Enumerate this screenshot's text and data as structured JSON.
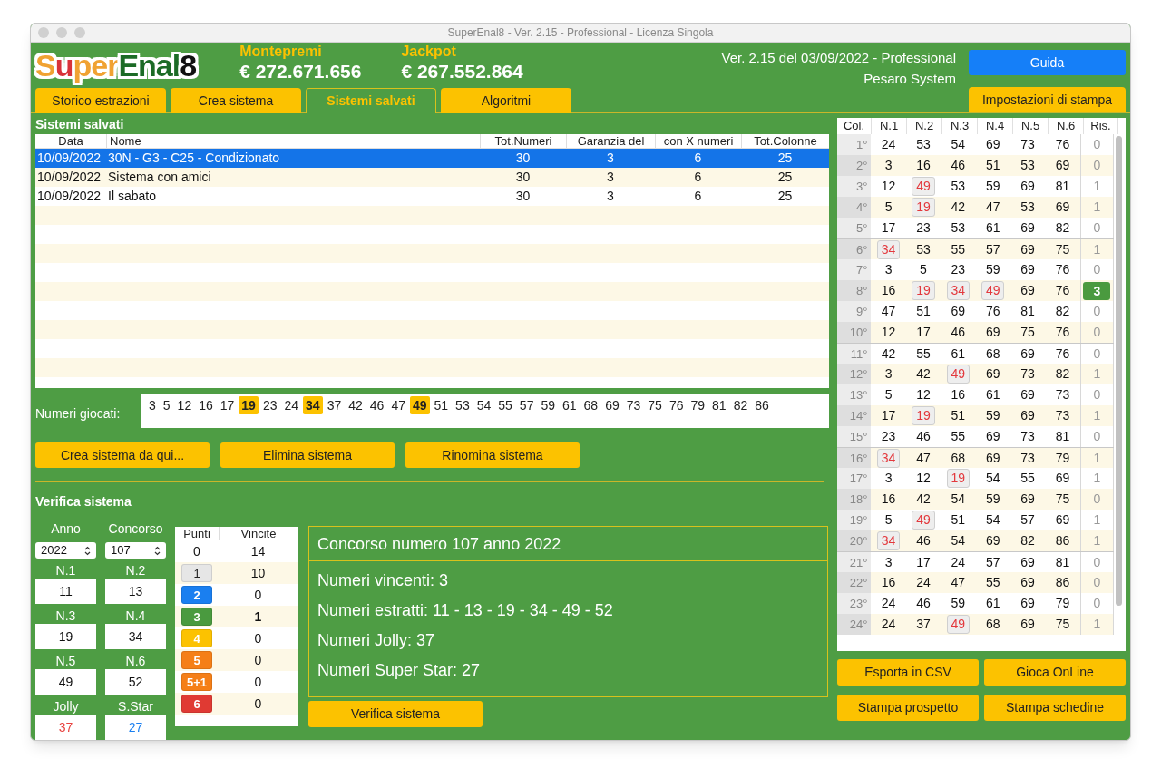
{
  "window": {
    "title": "SuperEnal8 - Ver. 2.15 - Professional - Licenza Singola"
  },
  "logo": [
    {
      "text": "S",
      "color": "#f0a232"
    },
    {
      "text": "u",
      "color": "#d8323a"
    },
    {
      "text": "per",
      "color": "#f0a232"
    },
    {
      "text": "Enal",
      "color": "#1c6b26"
    },
    {
      "text": "8",
      "color": "#111111"
    }
  ],
  "prizes": [
    {
      "label": "Montepremi",
      "amount": "€ 272.671.656"
    },
    {
      "label": "Jackpot",
      "amount": "€ 267.552.864"
    }
  ],
  "version": [
    "Ver. 2.15 del 03/09/2022 - Professional",
    "Pesaro System"
  ],
  "guide_button": "Guida",
  "tabs": [
    {
      "label": "Storico estrazioni",
      "selected": false
    },
    {
      "label": "Crea sistema",
      "selected": false
    },
    {
      "label": "Sistemi salvati",
      "selected": true
    },
    {
      "label": "Algoritmi",
      "selected": false
    }
  ],
  "print_settings_button": "Impostazioni di stampa",
  "saved_systems": {
    "title": "Sistemi salvati",
    "columns": [
      "Data",
      "Nome",
      "Tot.Numeri",
      "Garanzia del",
      "con X numeri",
      "Tot.Colonne"
    ],
    "rows": [
      {
        "cells": [
          "10/09/2022",
          "30N - G3 - C25 - Condizionato",
          "30",
          "3",
          "6",
          "25"
        ],
        "selected": true
      },
      {
        "cells": [
          "10/09/2022",
          "Sistema con amici",
          "30",
          "3",
          "6",
          "25"
        ],
        "selected": false
      },
      {
        "cells": [
          "10/09/2022",
          "Il sabato",
          "30",
          "3",
          "6",
          "25"
        ],
        "selected": false
      }
    ]
  },
  "played_numbers": {
    "label": "Numeri giocati:",
    "numbers": [
      {
        "value": "3",
        "hit": false
      },
      {
        "value": "5",
        "hit": false
      },
      {
        "value": "12",
        "hit": false
      },
      {
        "value": "16",
        "hit": false
      },
      {
        "value": "17",
        "hit": false
      },
      {
        "value": "19",
        "hit": true
      },
      {
        "value": "23",
        "hit": false
      },
      {
        "value": "24",
        "hit": false
      },
      {
        "value": "34",
        "hit": true
      },
      {
        "value": "37",
        "hit": false
      },
      {
        "value": "42",
        "hit": false
      },
      {
        "value": "46",
        "hit": false
      },
      {
        "value": "47",
        "hit": false
      },
      {
        "value": "49",
        "hit": true
      },
      {
        "value": "51",
        "hit": false
      },
      {
        "value": "53",
        "hit": false
      },
      {
        "value": "54",
        "hit": false
      },
      {
        "value": "55",
        "hit": false
      },
      {
        "value": "57",
        "hit": false
      },
      {
        "value": "59",
        "hit": false
      },
      {
        "value": "61",
        "hit": false
      },
      {
        "value": "68",
        "hit": false
      },
      {
        "value": "69",
        "hit": false
      },
      {
        "value": "73",
        "hit": false
      },
      {
        "value": "75",
        "hit": false
      },
      {
        "value": "76",
        "hit": false
      },
      {
        "value": "79",
        "hit": false
      },
      {
        "value": "81",
        "hit": false
      },
      {
        "value": "82",
        "hit": false
      },
      {
        "value": "86",
        "hit": false
      }
    ]
  },
  "system_buttons": [
    "Crea sistema da qui...",
    "Elimina sistema",
    "Rinomina sistema"
  ],
  "verify": {
    "title": "Verifica sistema",
    "year": {
      "label": "Anno",
      "value": "2022"
    },
    "contest": {
      "label": "Concorso",
      "value": "107"
    },
    "fields": [
      {
        "label": "N.1",
        "value": "11",
        "color": "#111111"
      },
      {
        "label": "N.2",
        "value": "13",
        "color": "#111111"
      },
      {
        "label": "N.3",
        "value": "19",
        "color": "#111111"
      },
      {
        "label": "N.4",
        "value": "34",
        "color": "#111111"
      },
      {
        "label": "N.5",
        "value": "49",
        "color": "#111111"
      },
      {
        "label": "N.6",
        "value": "52",
        "color": "#111111"
      },
      {
        "label": "Jolly",
        "value": "37",
        "color": "#e8423f"
      },
      {
        "label": "S.Star",
        "value": "27",
        "color": "#1a7ff0"
      }
    ],
    "points_columns": [
      "Punti",
      "Vincite"
    ],
    "points": [
      {
        "points": "0",
        "wins": "14",
        "winning": false
      },
      {
        "points": "1",
        "wins": "10",
        "color": "#e6e6e6",
        "winning": false
      },
      {
        "points": "2",
        "wins": "0",
        "color": "#1a7ff0",
        "winning": false
      },
      {
        "points": "3",
        "wins": "1",
        "color": "#4a9a3f",
        "winning": true
      },
      {
        "points": "4",
        "wins": "0",
        "color": "#fcc200",
        "winning": false
      },
      {
        "points": "5",
        "wins": "0",
        "color": "#f57f17",
        "winning": false
      },
      {
        "points": "5+1",
        "wins": "0",
        "color": "#f57f17",
        "winning": false
      },
      {
        "points": "6",
        "wins": "0",
        "color": "#e03a33",
        "winning": false
      }
    ],
    "result_title": "Concorso numero 107 anno 2022",
    "result_lines": [
      "Numeri vincenti: 3",
      "Numeri estratti: 11 - 13 - 19 - 34 - 49 - 52",
      "Numeri Jolly: 37",
      "Numeri Super Star: 27"
    ],
    "button": "Verifica sistema"
  },
  "columns_table": {
    "columns": [
      "Col.",
      "N.1",
      "N.2",
      "N.3",
      "N.4",
      "N.5",
      "N.6",
      "Ris."
    ],
    "rows": [
      {
        "col": "1°",
        "numbers": [
          "24",
          "53",
          "54",
          "69",
          "73",
          "76"
        ],
        "hits": [
          false,
          false,
          false,
          false,
          false,
          false
        ],
        "ris": "0",
        "winning": false
      },
      {
        "col": "2°",
        "numbers": [
          "3",
          "16",
          "46",
          "51",
          "53",
          "69"
        ],
        "hits": [
          false,
          false,
          false,
          false,
          false,
          false
        ],
        "ris": "0",
        "winning": false
      },
      {
        "col": "3°",
        "numbers": [
          "12",
          "49",
          "53",
          "59",
          "69",
          "81"
        ],
        "hits": [
          false,
          true,
          false,
          false,
          false,
          false
        ],
        "ris": "1",
        "winning": false
      },
      {
        "col": "4°",
        "numbers": [
          "5",
          "19",
          "42",
          "47",
          "53",
          "69"
        ],
        "hits": [
          false,
          true,
          false,
          false,
          false,
          false
        ],
        "ris": "1",
        "winning": false
      },
      {
        "col": "5°",
        "numbers": [
          "17",
          "23",
          "53",
          "61",
          "69",
          "82"
        ],
        "hits": [
          false,
          false,
          false,
          false,
          false,
          false
        ],
        "ris": "0",
        "winning": false
      },
      {
        "col": "6°",
        "numbers": [
          "34",
          "53",
          "55",
          "57",
          "69",
          "75"
        ],
        "hits": [
          true,
          false,
          false,
          false,
          false,
          false
        ],
        "ris": "1",
        "winning": false
      },
      {
        "col": "7°",
        "numbers": [
          "3",
          "5",
          "23",
          "59",
          "69",
          "76"
        ],
        "hits": [
          false,
          false,
          false,
          false,
          false,
          false
        ],
        "ris": "0",
        "winning": false
      },
      {
        "col": "8°",
        "numbers": [
          "16",
          "19",
          "34",
          "49",
          "69",
          "76"
        ],
        "hits": [
          false,
          true,
          true,
          true,
          false,
          false
        ],
        "ris": "3",
        "winning": true
      },
      {
        "col": "9°",
        "numbers": [
          "47",
          "51",
          "69",
          "76",
          "81",
          "82"
        ],
        "hits": [
          false,
          false,
          false,
          false,
          false,
          false
        ],
        "ris": "0",
        "winning": false
      },
      {
        "col": "10°",
        "numbers": [
          "12",
          "17",
          "46",
          "69",
          "75",
          "76"
        ],
        "hits": [
          false,
          false,
          false,
          false,
          false,
          false
        ],
        "ris": "0",
        "winning": false
      },
      {
        "col": "11°",
        "numbers": [
          "42",
          "55",
          "61",
          "68",
          "69",
          "76"
        ],
        "hits": [
          false,
          false,
          false,
          false,
          false,
          false
        ],
        "ris": "0",
        "winning": false
      },
      {
        "col": "12°",
        "numbers": [
          "3",
          "42",
          "49",
          "69",
          "73",
          "82"
        ],
        "hits": [
          false,
          false,
          true,
          false,
          false,
          false
        ],
        "ris": "1",
        "winning": false
      },
      {
        "col": "13°",
        "numbers": [
          "5",
          "12",
          "16",
          "61",
          "69",
          "73"
        ],
        "hits": [
          false,
          false,
          false,
          false,
          false,
          false
        ],
        "ris": "0",
        "winning": false
      },
      {
        "col": "14°",
        "numbers": [
          "17",
          "19",
          "51",
          "59",
          "69",
          "73"
        ],
        "hits": [
          false,
          true,
          false,
          false,
          false,
          false
        ],
        "ris": "1",
        "winning": false
      },
      {
        "col": "15°",
        "numbers": [
          "23",
          "46",
          "55",
          "69",
          "73",
          "81"
        ],
        "hits": [
          false,
          false,
          false,
          false,
          false,
          false
        ],
        "ris": "0",
        "winning": false
      },
      {
        "col": "16°",
        "numbers": [
          "34",
          "47",
          "68",
          "69",
          "73",
          "79"
        ],
        "hits": [
          true,
          false,
          false,
          false,
          false,
          false
        ],
        "ris": "1",
        "winning": false
      },
      {
        "col": "17°",
        "numbers": [
          "3",
          "12",
          "19",
          "54",
          "55",
          "69"
        ],
        "hits": [
          false,
          false,
          true,
          false,
          false,
          false
        ],
        "ris": "1",
        "winning": false
      },
      {
        "col": "18°",
        "numbers": [
          "16",
          "42",
          "54",
          "59",
          "69",
          "75"
        ],
        "hits": [
          false,
          false,
          false,
          false,
          false,
          false
        ],
        "ris": "0",
        "winning": false
      },
      {
        "col": "19°",
        "numbers": [
          "5",
          "49",
          "51",
          "54",
          "57",
          "69"
        ],
        "hits": [
          false,
          true,
          false,
          false,
          false,
          false
        ],
        "ris": "1",
        "winning": false
      },
      {
        "col": "20°",
        "numbers": [
          "34",
          "46",
          "54",
          "69",
          "82",
          "86"
        ],
        "hits": [
          true,
          false,
          false,
          false,
          false,
          false
        ],
        "ris": "1",
        "winning": false
      },
      {
        "col": "21°",
        "numbers": [
          "3",
          "17",
          "24",
          "57",
          "69",
          "81"
        ],
        "hits": [
          false,
          false,
          false,
          false,
          false,
          false
        ],
        "ris": "0",
        "winning": false
      },
      {
        "col": "22°",
        "numbers": [
          "16",
          "24",
          "47",
          "55",
          "69",
          "86"
        ],
        "hits": [
          false,
          false,
          false,
          false,
          false,
          false
        ],
        "ris": "0",
        "winning": false
      },
      {
        "col": "23°",
        "numbers": [
          "24",
          "46",
          "59",
          "61",
          "69",
          "79"
        ],
        "hits": [
          false,
          false,
          false,
          false,
          false,
          false
        ],
        "ris": "0",
        "winning": false
      },
      {
        "col": "24°",
        "numbers": [
          "24",
          "37",
          "49",
          "68",
          "69",
          "75"
        ],
        "hits": [
          false,
          false,
          true,
          false,
          false,
          false
        ],
        "ris": "1",
        "winning": false
      }
    ]
  },
  "export_buttons": [
    "Esporta in CSV",
    "Gioca OnLine",
    "Stampa prospetto",
    "Stampa schedine"
  ]
}
